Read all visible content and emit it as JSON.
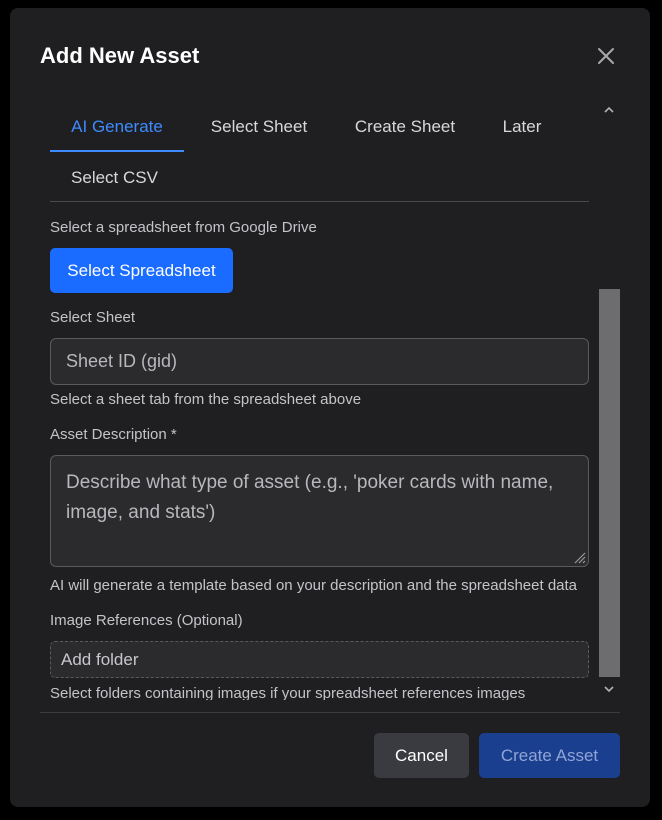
{
  "dialog": {
    "title": "Add New Asset",
    "close_icon": "close-icon"
  },
  "tabs": [
    {
      "label": "AI Generate",
      "active": true
    },
    {
      "label": "Select Sheet",
      "active": false
    },
    {
      "label": "Create Sheet",
      "active": false
    },
    {
      "label": "Later",
      "active": false
    },
    {
      "label": "Select CSV",
      "active": false
    }
  ],
  "form": {
    "drive_hint": "Select a spreadsheet from Google Drive",
    "select_spreadsheet_label": "Select Spreadsheet",
    "select_sheet_label": "Select Sheet",
    "sheet_id_placeholder": "Sheet ID (gid)",
    "sheet_help": "Select a sheet tab from the spreadsheet above",
    "asset_description_label": "Asset Description *",
    "asset_description_placeholder": "Describe what type of asset (e.g., 'poker cards with name, image, and stats')",
    "asset_description_help": "AI will generate a template based on your description and the spreadsheet data",
    "image_references_label": "Image References (Optional)",
    "add_folder_label": "Add folder",
    "image_references_help": "Select folders containing images if your spreadsheet references images"
  },
  "footer": {
    "cancel_label": "Cancel",
    "create_label": "Create Asset"
  },
  "colors": {
    "accent": "#3d8bff",
    "primary_button": "#1a6bff",
    "disabled_button": "#1b3f8f",
    "modal_background": "#1f1f21"
  }
}
